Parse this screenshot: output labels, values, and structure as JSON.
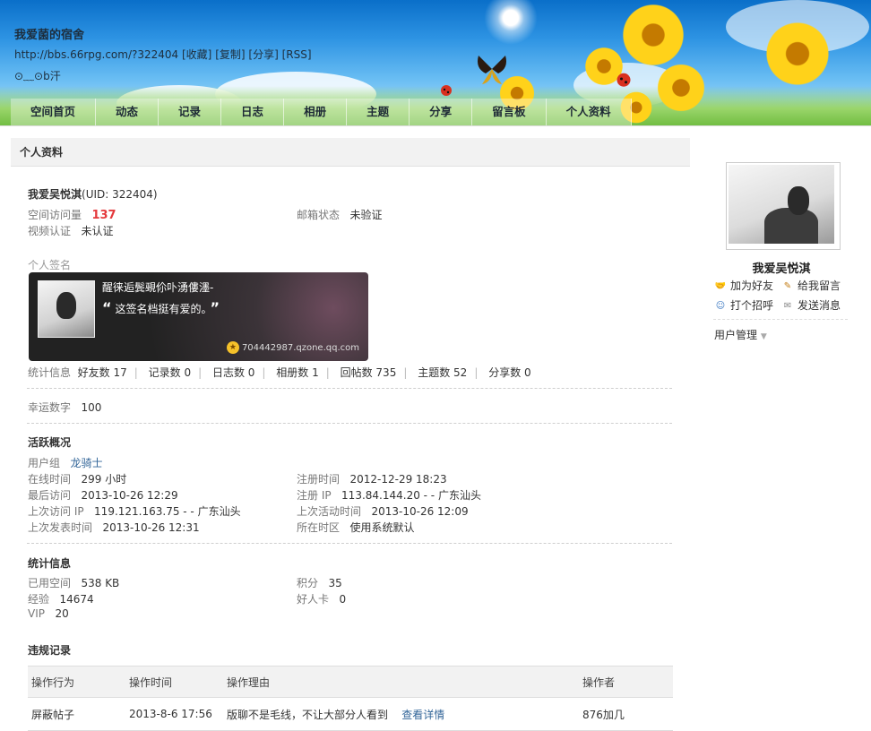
{
  "header": {
    "site_title": "我爱菌的宿舍",
    "url": "http://bbs.66rpg.com/?322404",
    "links": [
      "[收藏]",
      "[复制]",
      "[分享]",
      "[RSS]"
    ],
    "motto": "⊙﹏⊙b汗"
  },
  "nav": {
    "items": [
      "空间首页",
      "动态",
      "记录",
      "日志",
      "相册",
      "主题",
      "分享",
      "留言板",
      "个人资料"
    ]
  },
  "profile": {
    "section_title": "个人资料",
    "name": "我爱吴悦淇",
    "uid": "(UID: 322404)",
    "visits_label": "空间访问量",
    "visits_value": "137",
    "email_label": "邮箱状态",
    "email_value": "未验证",
    "video_label": "视频认证",
    "video_value": "未认证",
    "signature_label": "个人签名",
    "signature_name": "醒徕逅鬓覡伱卟湧僂濹-",
    "signature_text": "这签名档挺有爱的。",
    "signature_url": "704442987.qzone.qq.com",
    "stats_prefix": "统计信息",
    "stats": [
      "好友数 17",
      "记录数 0",
      "日志数 0",
      "相册数 1",
      "回帖数 735",
      "主题数 52",
      "分享数 0"
    ],
    "lucky_label": "幸运数字",
    "lucky_value": "100"
  },
  "activity": {
    "title": "活跃概况",
    "usergroup_label": "用户组",
    "usergroup_value": "龙骑士",
    "online_label": "在线时间",
    "online_value": "299 小时",
    "register_label": "注册时间",
    "register_value": "2012-12-29 18:23",
    "last_visit_label": "最后访问",
    "last_visit_value": "2013-10-26 12:29",
    "register_ip_label": "注册 IP",
    "register_ip_value": "113.84.144.20 - - 广东汕头",
    "last_ip_label": "上次访问 IP",
    "last_ip_value": "119.121.163.75 - - 广东汕头",
    "last_active_label": "上次活动时间",
    "last_active_value": "2013-10-26 12:09",
    "last_post_label": "上次发表时间",
    "last_post_value": "2013-10-26 12:31",
    "timezone_label": "所在时区",
    "timezone_value": "使用系统默认"
  },
  "statistics": {
    "title": "统计信息",
    "space_label": "已用空间",
    "space_value": "538 KB",
    "points_label": "积分",
    "points_value": "35",
    "exp_label": "经验",
    "exp_value": "14674",
    "goodcard_label": "好人卡",
    "goodcard_value": "0",
    "vip_label": "VIP",
    "vip_value": "20"
  },
  "violations": {
    "title": "违规记录",
    "columns": [
      "操作行为",
      "操作时间",
      "操作理由",
      "操作者"
    ],
    "rows": [
      {
        "action": "屏蔽帖子",
        "time": "2013-8-6 17:56",
        "reason": "版聊不是毛线，不让大部分人看到",
        "detail_link": "查看详情",
        "operator": "876加几"
      }
    ]
  },
  "sidebar": {
    "name": "我爱吴悦淇",
    "add_friend": "加为好友",
    "leave_message": "给我留言",
    "greet": "打个招呼",
    "send_message": "发送消息",
    "user_manage": "用户管理"
  }
}
